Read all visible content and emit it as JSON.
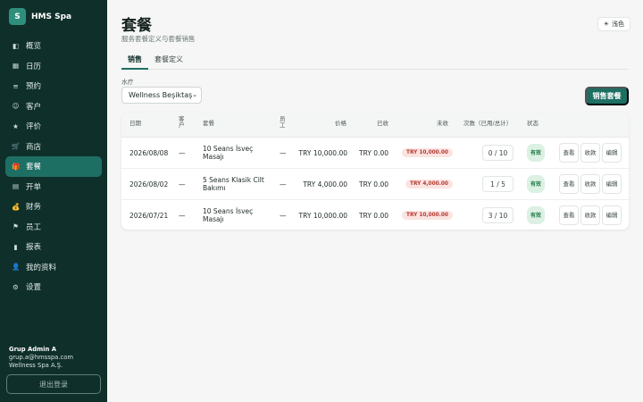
{
  "brand": {
    "logo": "S",
    "name": "HMS Spa"
  },
  "nav": [
    {
      "label": "概览",
      "icon": "◧"
    },
    {
      "label": "日历",
      "icon": "▦"
    },
    {
      "label": "预约",
      "icon": "≡"
    },
    {
      "label": "客户",
      "icon": "☺"
    },
    {
      "label": "评价",
      "icon": "★"
    },
    {
      "label": "商店",
      "icon": "🛒"
    },
    {
      "label": "套餐",
      "icon": "🎁"
    },
    {
      "label": "开单",
      "icon": "▤"
    },
    {
      "label": "财务",
      "icon": "💰"
    },
    {
      "label": "员工",
      "icon": "⚑"
    },
    {
      "label": "报表",
      "icon": "▮"
    },
    {
      "label": "我的资料",
      "icon": "👤"
    },
    {
      "label": "设置",
      "icon": "⚙"
    }
  ],
  "user": {
    "name": "Grup Admin A",
    "email": "grup.a@hmsspa.com",
    "company": "Wellness Spa A.Ş."
  },
  "logout_label": "退出登录",
  "page": {
    "title": "套餐",
    "subtitle": "服务套餐定义与套餐销售",
    "theme_label": "浅色"
  },
  "tabs": [
    {
      "label": "销售"
    },
    {
      "label": "套餐定义"
    }
  ],
  "filter": {
    "label": "水疗",
    "value": "Wellness Beşiktaş"
  },
  "sell_button": "销售套餐",
  "table": {
    "headers": {
      "date": "日期",
      "customer": "客户",
      "package": "套餐",
      "staff": "员工",
      "price": "价格",
      "paid": "已收",
      "unpaid": "未收",
      "count": "次数（已用/总计）",
      "status": "状态"
    },
    "rows": [
      {
        "date": "2026/08/08",
        "customer": "—",
        "package": "10 Seans İsveç Masajı",
        "staff": "—",
        "price": "TRY 10,000.00",
        "paid": "TRY 0.00",
        "unpaid": "TRY 10,000.00",
        "count": "0 / 10",
        "status": "有效"
      },
      {
        "date": "2026/08/02",
        "customer": "—",
        "package": "5 Seans Klasik Cilt Bakımı",
        "staff": "—",
        "price": "TRY 4,000.00",
        "paid": "TRY 0.00",
        "unpaid": "TRY 4,000.00",
        "count": "1 / 5",
        "status": "有效"
      },
      {
        "date": "2026/07/21",
        "customer": "—",
        "package": "10 Seans İsveç Masajı",
        "staff": "—",
        "price": "TRY 10,000.00",
        "paid": "TRY 0.00",
        "unpaid": "TRY 10,000.00",
        "count": "3 / 10",
        "status": "有效"
      }
    ],
    "actions": {
      "view": "查看",
      "collect": "收款",
      "edit": "编辑"
    }
  },
  "colors": {
    "sidebar": "#0f2f2a",
    "accent": "#1e6f63",
    "unpaid": "#b43b32",
    "status": "#1f7a46"
  }
}
